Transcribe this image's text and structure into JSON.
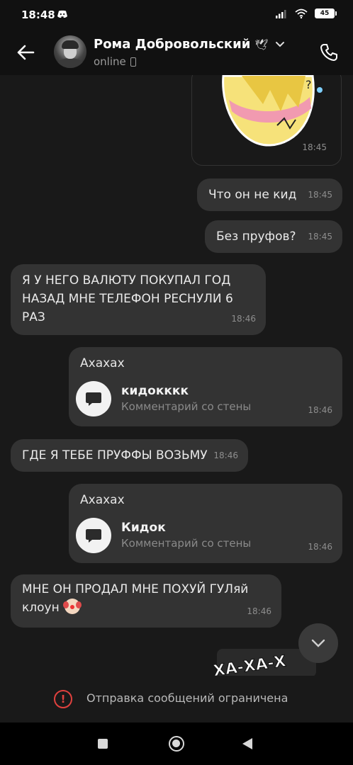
{
  "status_bar": {
    "time": "18:48",
    "battery": "45"
  },
  "header": {
    "contact_name": "Рома Добровольский",
    "status": "online"
  },
  "messages": [
    {
      "type": "sticker",
      "time": "18:45"
    },
    {
      "type": "outgoing",
      "text": "Что он не кид",
      "time": "18:45"
    },
    {
      "type": "outgoing",
      "text": "Без пруфов?",
      "time": "18:45"
    },
    {
      "type": "incoming",
      "text": "Я У НЕГО ВАЛЮТУ ПОКУПАЛ ГОД НАЗАД МНЕ ТЕЛЕФОН РЕСНУЛИ 6 РАЗ",
      "time": "18:46"
    },
    {
      "type": "outgoing_attachment",
      "text": "Ахахах",
      "attachment_title": "кидокккк",
      "attachment_subtitle": "Комментарий со стены",
      "time": "18:46"
    },
    {
      "type": "incoming",
      "text": "ГДЕ Я ТЕБЕ ПРУФФЫ ВОЗЬМУ",
      "time": "18:46"
    },
    {
      "type": "outgoing_attachment",
      "text": "Ахахах",
      "attachment_title": "Кидок",
      "attachment_subtitle": "Комментарий со стены",
      "time": "18:46"
    },
    {
      "type": "incoming",
      "text": "МНЕ ОН ПРОДАЛ МНЕ ПОХУЙ ГУЛяй клоун",
      "time": "18:46"
    }
  ],
  "partial_sticker_text": "ХА-ХА-Х",
  "restriction": {
    "text": "Отправка сообщений ограничена",
    "icon": "!"
  },
  "colors": {
    "background": "#191919",
    "bubble": "#333333",
    "alert": "#e0413e"
  }
}
